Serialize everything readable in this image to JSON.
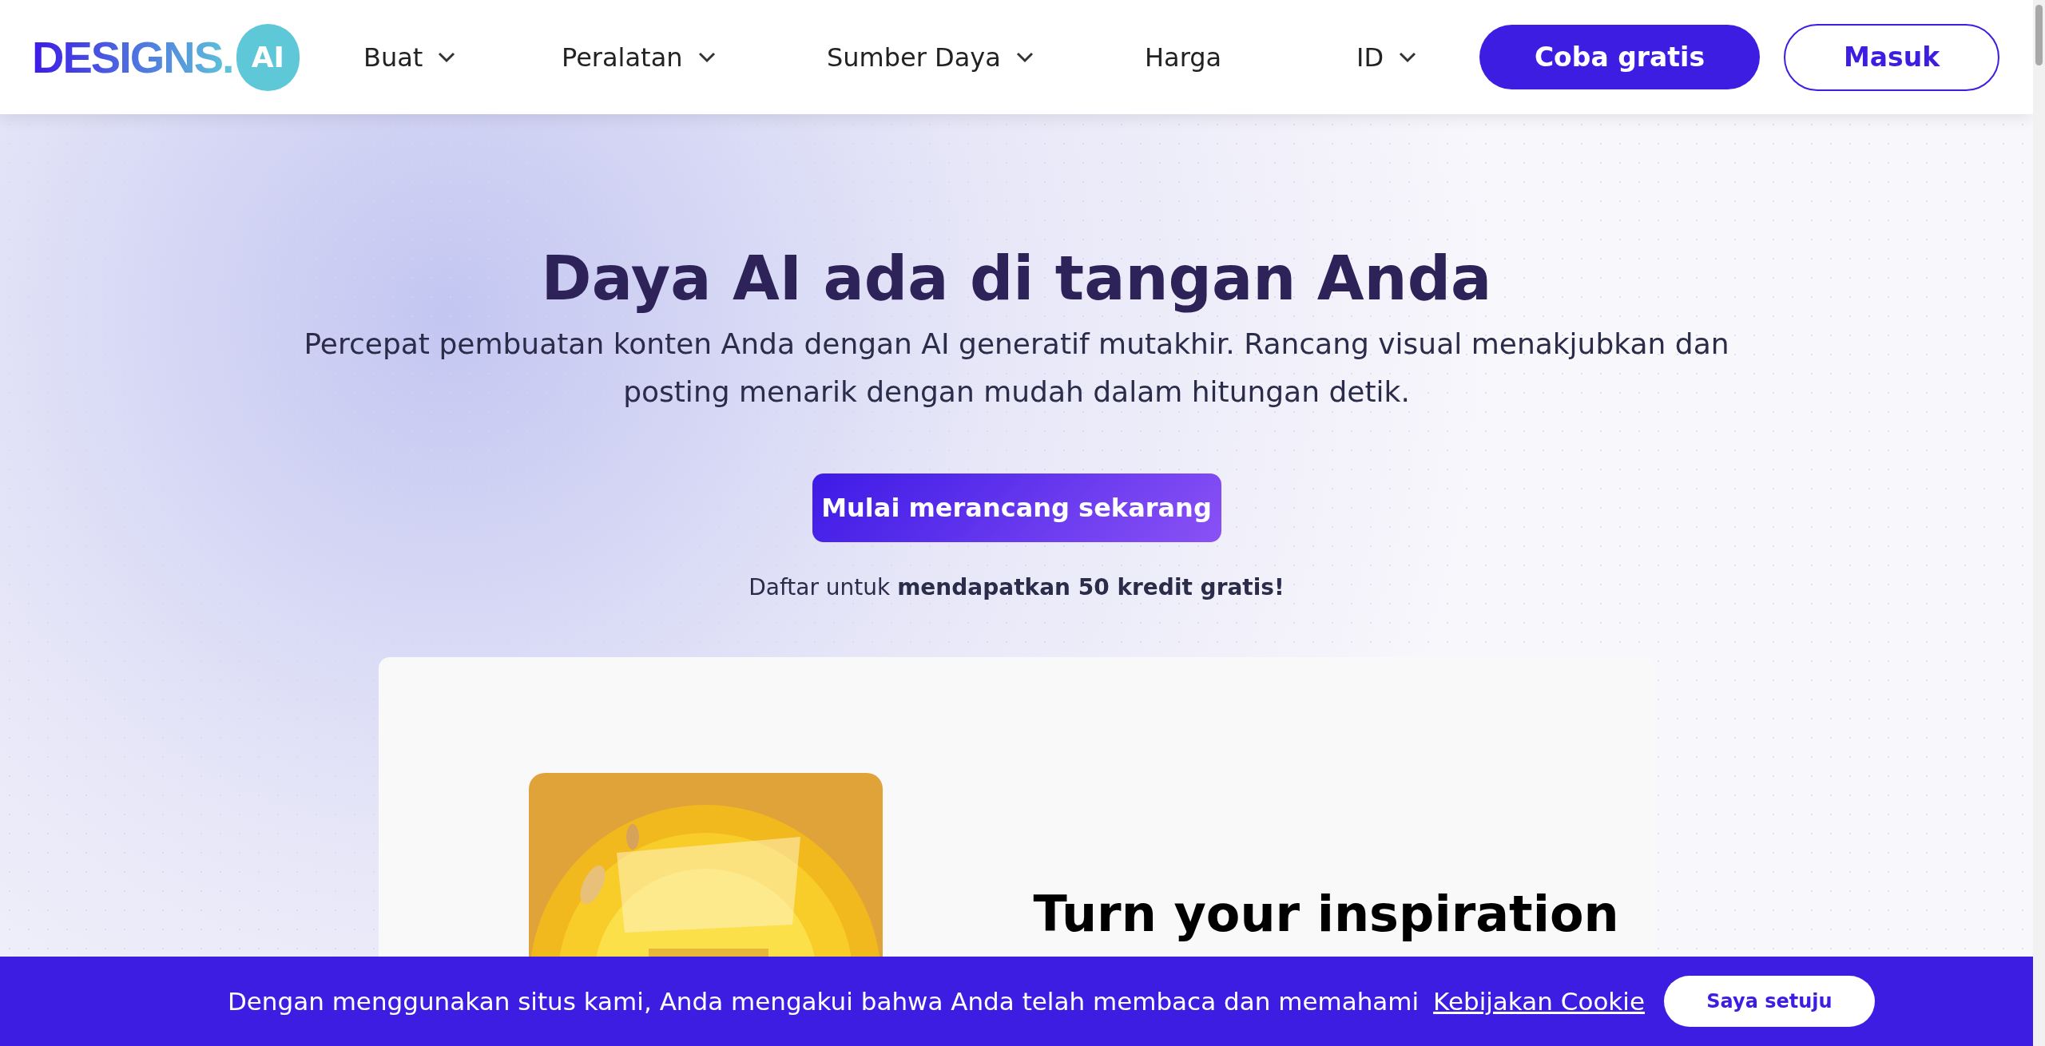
{
  "header": {
    "logo": {
      "text": "DESIGNS.",
      "badge": "AI"
    },
    "nav": [
      {
        "label": "Buat",
        "dropdown": true
      },
      {
        "label": "Peralatan",
        "dropdown": true
      },
      {
        "label": "Sumber Daya",
        "dropdown": true
      },
      {
        "label": "Harga",
        "dropdown": false
      },
      {
        "label": "ID",
        "dropdown": true
      }
    ],
    "buttons": [
      {
        "label": "Coba gratis",
        "kind": "primary"
      },
      {
        "label": "Masuk",
        "kind": "outline"
      }
    ]
  },
  "hero": {
    "title": "Daya AI ada di tangan Anda",
    "subtitle": "Percepat pembuatan konten Anda dengan AI generatif mutakhir. Rancang visual menakjubkan dan posting menarik dengan mudah dalam hitungan detik.",
    "cta": "Mulai merancang sekarang",
    "note": "Daftar untuk **mendapatkan 50 kredit gratis!**"
  },
  "showcase": {
    "heading": "Turn your inspiration"
  },
  "cookie_bar": {
    "text": "Dengan menggunakan situs kami, Anda mengakui bahwa Anda telah membaca dan memahami",
    "link": "Kebijakan Cookie",
    "button": "Saya setuju"
  }
}
